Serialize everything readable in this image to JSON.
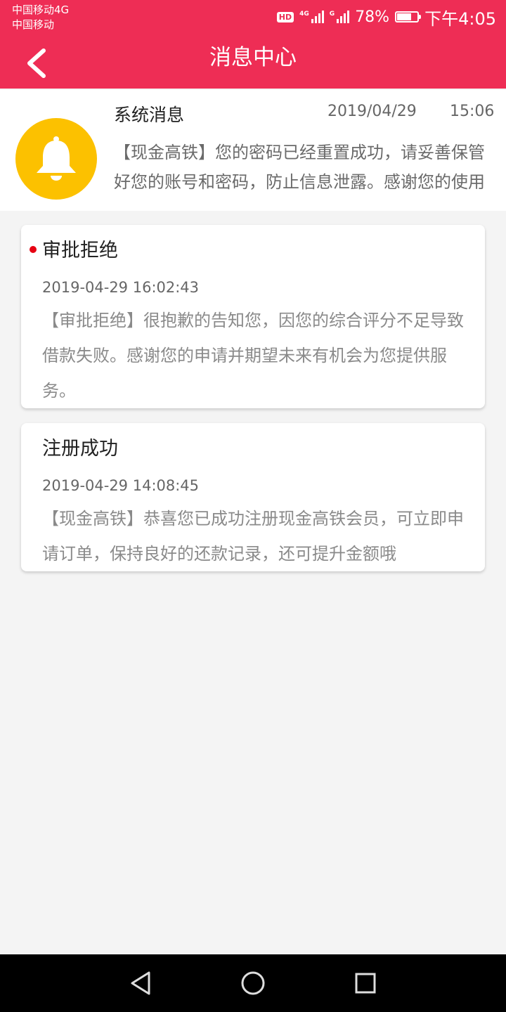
{
  "status_bar": {
    "carrier_primary": "中国移动4G",
    "carrier_secondary": "中国移动",
    "hd_badge": "HD",
    "network_1": "4G",
    "network_2": "G",
    "battery_percent": "78%",
    "battery_level": 0.78,
    "time": "下午4:05"
  },
  "header": {
    "title": "消息中心",
    "back_icon": "chevron-left-icon"
  },
  "system_message": {
    "icon": "bell-icon",
    "title": "系统消息",
    "date": "2019/04/29",
    "time": "15:06",
    "preview": "【现金高铁】您的密码已经重置成功，请妥善保管好您的账号和密码，防止信息泄露。感谢您的使用"
  },
  "messages": [
    {
      "title": "审批拒绝",
      "unread": true,
      "time": "2019-04-29 16:02:43",
      "body": "【审批拒绝】很抱歉的告知您，因您的综合评分不足导致借款失败。感谢您的申请并期望未来有机会为您提供服务。"
    },
    {
      "title": "注册成功",
      "unread": false,
      "time": "2019-04-29 14:08:45",
      "body": "【现金高铁】恭喜您已成功注册现金高铁会员，可立即申请订单，保持良好的还款记录，还可提升金额哦"
    }
  ],
  "nav_bar": {
    "back_icon": "triangle-back-icon",
    "home_icon": "circle-home-icon",
    "recents_icon": "square-recents-icon"
  },
  "colors": {
    "header": "#ee2d55",
    "bell_background": "#fcc100",
    "unread_dot": "#e60012",
    "page_background": "#f4f4f4"
  }
}
